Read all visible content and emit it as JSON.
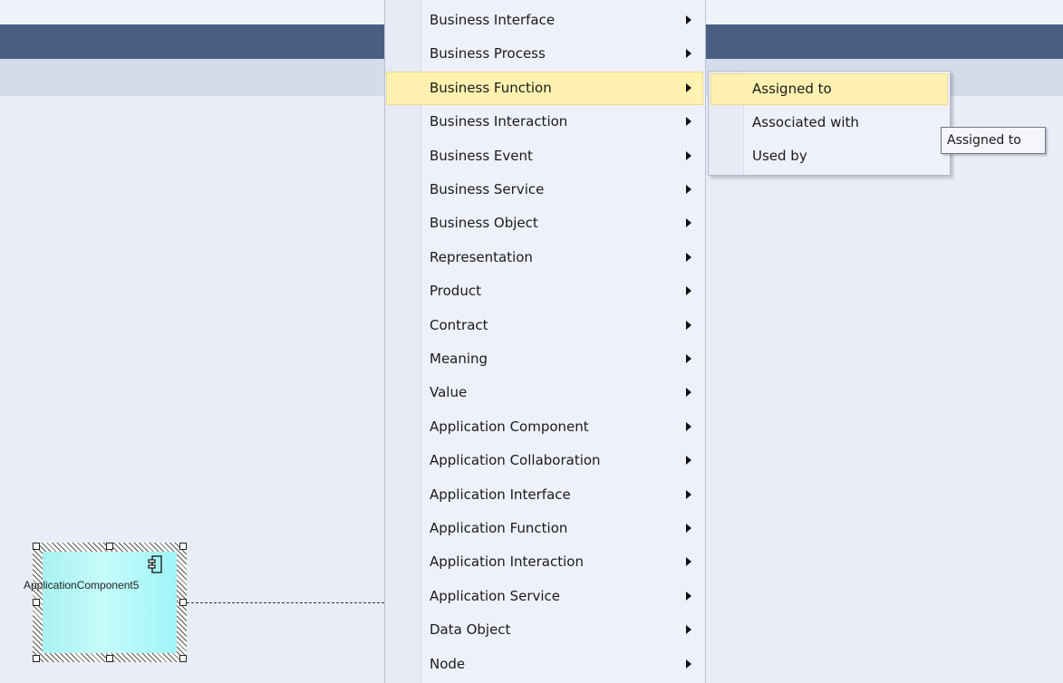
{
  "menu": {
    "items": [
      {
        "label": "Business Interface"
      },
      {
        "label": "Business Process"
      },
      {
        "label": "Business Function"
      },
      {
        "label": "Business Interaction"
      },
      {
        "label": "Business Event"
      },
      {
        "label": "Business Service"
      },
      {
        "label": "Business Object"
      },
      {
        "label": "Representation"
      },
      {
        "label": "Product"
      },
      {
        "label": "Contract"
      },
      {
        "label": "Meaning"
      },
      {
        "label": "Value"
      },
      {
        "label": "Application Component"
      },
      {
        "label": "Application Collaboration"
      },
      {
        "label": "Application Interface"
      },
      {
        "label": "Application Function"
      },
      {
        "label": "Application Interaction"
      },
      {
        "label": "Application Service"
      },
      {
        "label": "Data Object"
      },
      {
        "label": "Node"
      }
    ],
    "highlighted": "Business Function"
  },
  "submenu": {
    "items": [
      {
        "label": "Assigned to"
      },
      {
        "label": "Associated with"
      },
      {
        "label": "Used by"
      }
    ],
    "highlighted": "Assigned to"
  },
  "tooltip": {
    "text": "Assigned to"
  },
  "diagram": {
    "element_label": "ApplicationComponent5",
    "element_icon": "component-icon"
  },
  "colors": {
    "header_band": "#4b5f82",
    "highlight": "#fff2b0",
    "element_fill": "#b6f8f8"
  }
}
